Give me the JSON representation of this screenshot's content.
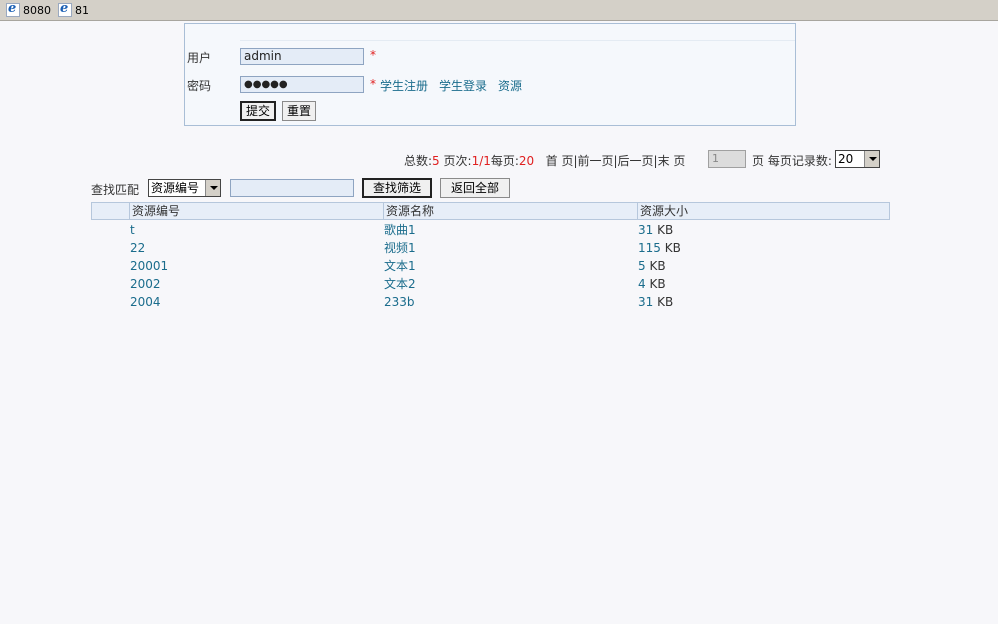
{
  "tabs": [
    {
      "label": "8080"
    },
    {
      "label": "81"
    }
  ],
  "login": {
    "user_label": "用户",
    "user_value": "admin",
    "password_label": "密码",
    "password_value": "●●●●●",
    "required_mark": "*",
    "links": [
      "学生注册",
      "学生登录",
      "资源"
    ],
    "submit_label": "提交",
    "reset_label": "重置"
  },
  "pager": {
    "total_label": "总数:",
    "total": "5",
    "page_label": "页次:",
    "page": "1/1",
    "per_page_label": "每页:",
    "per_page": "20",
    "nav": "首 页|前一页|后一页|末 页",
    "page_input": "1",
    "page_suffix": "页 每页记录数:",
    "records_select": "20"
  },
  "search": {
    "label": "查找匹配",
    "field_select": "资源编号",
    "filter_button": "查找筛选",
    "reset_button": "返回全部"
  },
  "table": {
    "headers": [
      "资源编号",
      "资源名称",
      "资源大小"
    ],
    "rows": [
      {
        "id": "t",
        "name": "歌曲1",
        "size": "31",
        "unit": "KB"
      },
      {
        "id": "22",
        "name": "视频1",
        "size": "115",
        "unit": "KB"
      },
      {
        "id": "20001",
        "name": "文本1",
        "size": "5",
        "unit": "KB"
      },
      {
        "id": "2002",
        "name": "文本2",
        "size": "4",
        "unit": "KB"
      },
      {
        "id": "2004",
        "name": "233b",
        "size": "31",
        "unit": "KB"
      }
    ]
  },
  "colors": {
    "link": "#1a6c8c",
    "required": "#e02020",
    "header_bg": "#e7eef8"
  }
}
